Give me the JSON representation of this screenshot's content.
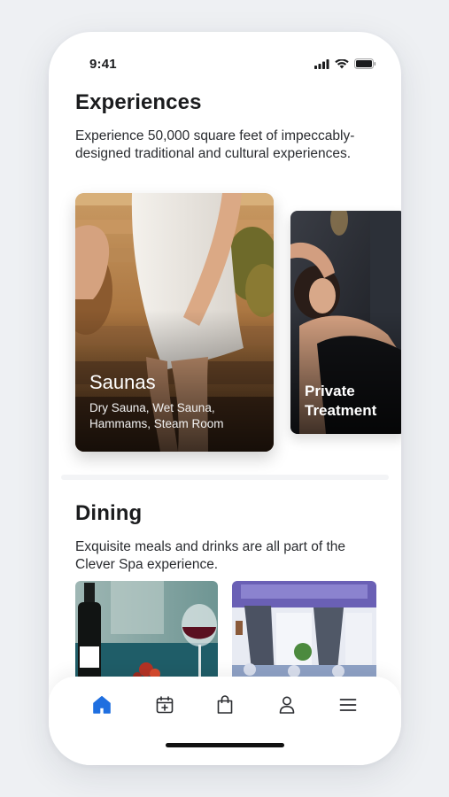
{
  "status_bar": {
    "time": "9:41"
  },
  "experiences": {
    "title": "Experiences",
    "description": "Experience 50,000 square feet of impeccably-designed traditional and cultural experiences.",
    "cards": [
      {
        "title": "Saunas",
        "subtitle_line1": "Dry Sauna, Wet Sauna,",
        "subtitle_line2": "Hammams, Steam Room"
      },
      {
        "title_line1": "Private",
        "title_line2": "Treatment"
      }
    ]
  },
  "dining": {
    "title": "Dining",
    "description": "Exquisite meals and drinks are all part of the Clever Spa experience."
  },
  "tabbar": {
    "active": "home",
    "items": [
      "home-icon",
      "calendar-add-icon",
      "shopping-bag-icon",
      "profile-icon",
      "menu-icon"
    ],
    "active_color": "#1f6fe0",
    "inactive_color": "#2b2d31"
  }
}
